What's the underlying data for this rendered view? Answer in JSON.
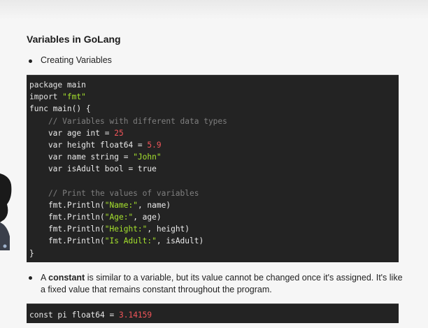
{
  "slide": {
    "title": "Variables in GoLang",
    "bullet1": "Creating Variables",
    "bullet2_part1": "A ",
    "bullet2_bold": "constant",
    "bullet2_part2": " is similar to a variable, but its value cannot be changed once it's assigned. It's like a fixed value that remains constant throughout the program."
  },
  "code": {
    "l1_kw": "package",
    "l1_rest": " main",
    "l2_kw": "import",
    "l2_str": "\"fmt\"",
    "l3": "func main() {",
    "l4": "    // Variables with different data types",
    "l5_a": "    var age int = ",
    "l5_n": "25",
    "l6_a": "    var height float64 = ",
    "l6_n": "5.9",
    "l7_a": "    var name string = ",
    "l7_s": "\"John\"",
    "l8": "    var isAdult bool = true",
    "l9": "",
    "l10": "    // Print the values of variables",
    "l11_a": "    fmt.Println(",
    "l11_s": "\"Name:\"",
    "l11_b": ", name)",
    "l12_a": "    fmt.Println(",
    "l12_s": "\"Age:\"",
    "l12_b": ", age)",
    "l13_a": "    fmt.Println(",
    "l13_s": "\"Height:\"",
    "l13_b": ", height)",
    "l14_a": "    fmt.Println(",
    "l14_s": "\"Is Adult:\"",
    "l14_b": ", isAdult)",
    "l15": "}"
  },
  "const_code": {
    "a": "const pi float64 = ",
    "n": "3.14159"
  },
  "colors": {
    "slide_bg": "#f6f6f6",
    "code_bg": "#232323",
    "string": "#a6e22e",
    "number": "#f2555a",
    "comment": "#7f7f7f"
  }
}
